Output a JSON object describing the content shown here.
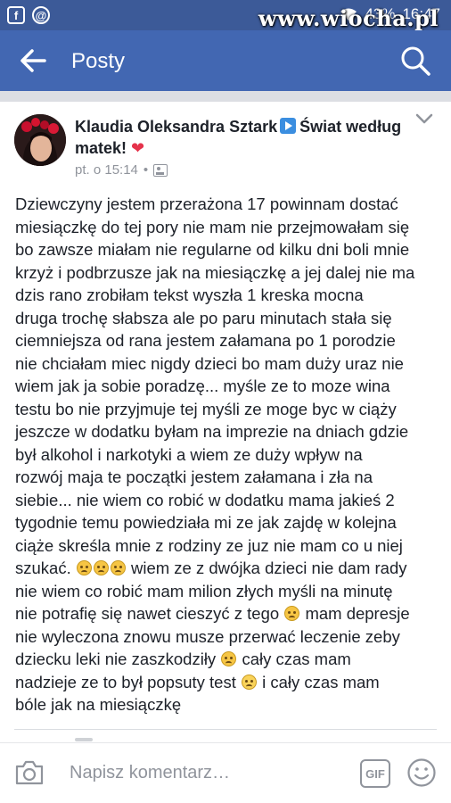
{
  "status_bar": {
    "battery": "43%",
    "time": "16:47",
    "watermark": "www.wiocha.pl",
    "left_icons": [
      "facebook-notification-icon",
      "messenger-notification-icon"
    ]
  },
  "app_bar": {
    "title": "Posty"
  },
  "post": {
    "author": "Klaudia Oleksandra Sztark",
    "group": "Świat według matek!",
    "heart": "❤",
    "meta": "pt. o 15:14",
    "separator": "•",
    "lines": [
      "Dziewczyny jestem przerażona 17 powinnam dostać",
      "miesiączkę do tej pory nie mam nie przejmowałam się",
      "bo zawsze miałam nie regularne od kilku dni boli mnie",
      "krzyż i podbrzusze jak na miesiączkę a jej dalej nie ma",
      "dzis rano zrobiłam tekst wyszła 1 kreska mocna",
      "druga trochę słabsza ale po paru minutach stała się",
      "ciemniejsza od rana jestem załamana po 1 porodzie",
      "nie chciałam miec nigdy dzieci bo mam duży uraz nie",
      "wiem jak ja sobie poradzę... myśle ze to moze wina",
      "testu bo nie przyjmuje tej myśli ze moge byc w ciąży",
      "jeszcze w dodatku byłam na imprezie na dniach gdzie",
      "był alkohol i narkotyki a wiem ze duży wpływ na",
      "rozwój maja te początki jestem załamana i zła na",
      "siebie... nie wiem co robić w dodatku mama jakieś 2",
      "tygodnie temu powiedziała mi ze jak zajdę w kolejna",
      "ciąże skreśla mnie z rodziny ze juz nie mam co u niej"
    ],
    "line17_a": "szukać.",
    "line17_b": "wiem ze z dwójka dzieci nie dam rady",
    "line18": "nie wiem co robić mam milion złych myśli na minutę",
    "line19_a": "nie potrafię się nawet cieszyć z tego",
    "line19_b": "mam depresje",
    "line20": "nie wyleczona znowu musze przerwać leczenie zeby",
    "line21_a": "dziecku leki nie zaszkodziły",
    "line21_b": "cały czas mam",
    "line22_a": "nadzieje ze to był popsuty test",
    "line22_b": "i cały czas mam",
    "line23": "bóle jak na miesiączkę"
  },
  "comment_bar": {
    "placeholder": "Napisz komentarz…",
    "gif_label": "GIF"
  },
  "colors": {
    "status_bar": "#3c5a98",
    "app_bar": "#4267b2",
    "heart": "#e5334b",
    "meta": "#90949c"
  }
}
